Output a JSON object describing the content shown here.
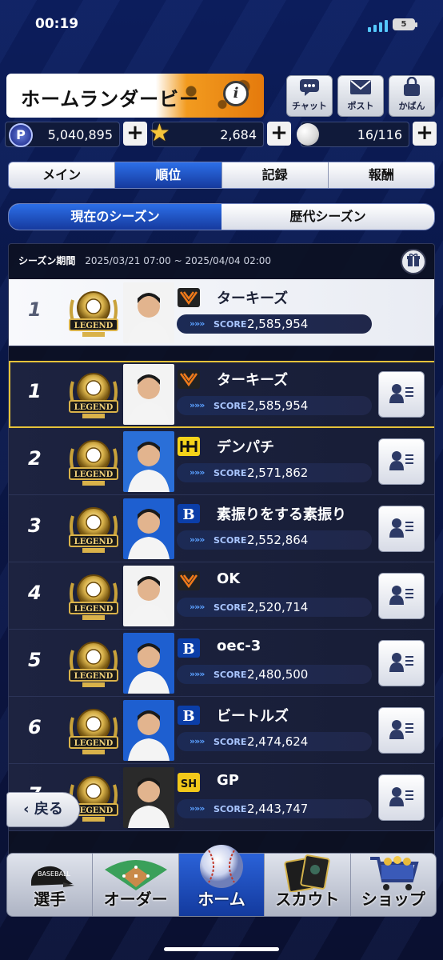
{
  "status_bar": {
    "time": "00:19",
    "battery": "5"
  },
  "header": {
    "title": "ホームランダービー",
    "info_label": "i",
    "buttons": [
      {
        "label": "チャット",
        "icon": "chat-icon"
      },
      {
        "label": "ポスト",
        "icon": "mail-icon"
      },
      {
        "label": "かばん",
        "icon": "bag-icon"
      }
    ]
  },
  "currency": {
    "points": {
      "icon_label": "P",
      "value": "5,040,895"
    },
    "stars": {
      "value": "2,684"
    },
    "balls": {
      "value": "16/116"
    }
  },
  "main_tabs": [
    {
      "label": "メイン",
      "active": false
    },
    {
      "label": "順位",
      "active": true
    },
    {
      "label": "記録",
      "active": false
    },
    {
      "label": "報酬",
      "active": false
    }
  ],
  "season_tabs": [
    {
      "label": "現在のシーズン",
      "active": true
    },
    {
      "label": "歴代シーズン",
      "active": false
    }
  ],
  "ranking": {
    "period_label": "シーズン期間",
    "period_value": "2025/03/21 07:00 ~ 2025/04/04 02:00",
    "score_label": "SCORE",
    "score_chevrons": "»»»",
    "my_entry": {
      "rank": "1",
      "name": "ターキーズ",
      "score": "2,585,954",
      "team": "giants"
    },
    "entries": [
      {
        "rank": "1",
        "name": "ターキーズ",
        "score": "2,585,954",
        "team": "giants",
        "highlight": true
      },
      {
        "rank": "2",
        "name": "デンパチ",
        "score": "2,571,862",
        "team": "tigers"
      },
      {
        "rank": "3",
        "name": "素振りをする素振り",
        "score": "2,552,864",
        "team": "baystars"
      },
      {
        "rank": "4",
        "name": "OK",
        "score": "2,520,714",
        "team": "giants"
      },
      {
        "rank": "5",
        "name": "oec-3",
        "score": "2,480,500",
        "team": "baystars"
      },
      {
        "rank": "6",
        "name": "ビートルズ",
        "score": "2,474,624",
        "team": "baystars"
      },
      {
        "rank": "7",
        "name": "GP",
        "score": "2,443,747",
        "team": "hawks"
      }
    ]
  },
  "back_button": {
    "label": "戻る",
    "icon": "chevron-left-icon"
  },
  "bottom_nav": [
    {
      "label": "選手",
      "icon": "baseball-cap-icon",
      "active": false
    },
    {
      "label": "オーダー",
      "icon": "baseball-field-icon",
      "active": false
    },
    {
      "label": "ホーム",
      "icon": "baseball-icon",
      "active": true
    },
    {
      "label": "スカウト",
      "icon": "cards-icon",
      "active": false
    },
    {
      "label": "ショップ",
      "icon": "shopping-cart-icon",
      "active": false
    }
  ],
  "colors": {
    "background": "#0b1747",
    "accent_blue": "#2c6fe8",
    "highlight_gold": "#e5c23a",
    "banner_orange": "#f29b1f"
  }
}
